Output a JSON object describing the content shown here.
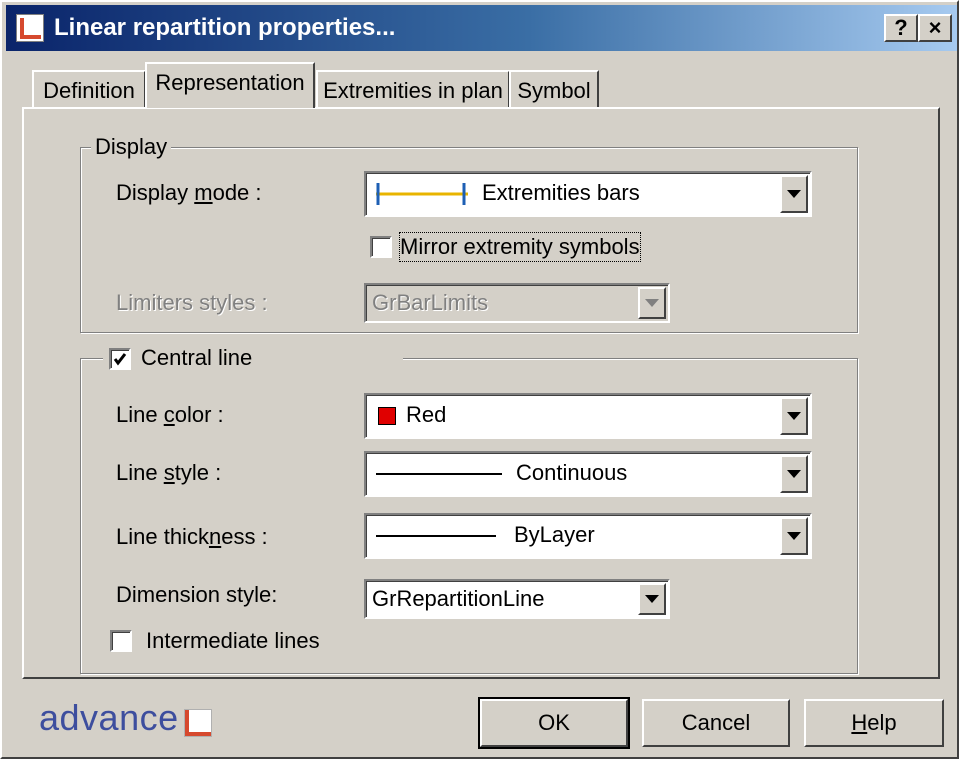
{
  "window": {
    "title": "Linear repartition properties...",
    "help_button": "?",
    "close_button": "×"
  },
  "tabs": [
    {
      "label": "Definition",
      "active": false
    },
    {
      "label": "Representation",
      "active": true
    },
    {
      "label": "Extremities in plan",
      "active": false
    },
    {
      "label": "Symbol",
      "active": false
    }
  ],
  "display_group": {
    "legend": "Display",
    "display_mode": {
      "label_pre": "Display ",
      "label_u": "m",
      "label_post": "ode :",
      "value": "Extremities bars"
    },
    "mirror_checkbox": {
      "label": "Mirror extremity symbols",
      "checked": false
    },
    "limiters_styles": {
      "label": "Limiters styles :",
      "value": "GrBarLimits",
      "disabled": true
    }
  },
  "central_group": {
    "legend": "Central line",
    "checked": true,
    "line_color": {
      "label_pre": "Line ",
      "label_u": "c",
      "label_post": "olor :",
      "value": "Red",
      "swatch": "#e00000"
    },
    "line_style": {
      "label_pre": "Line ",
      "label_u": "s",
      "label_post": "tyle :",
      "value": "Continuous"
    },
    "line_thickness": {
      "label_pre": "Line thick",
      "label_u": "n",
      "label_post": "ess :",
      "value": "ByLayer"
    },
    "dimension_style": {
      "label": "Dimension style:",
      "value": "GrRepartitionLine"
    },
    "intermediate_lines": {
      "label": "Intermediate lines",
      "checked": false
    }
  },
  "footer": {
    "brand": "advance",
    "ok": "OK",
    "cancel": "Cancel",
    "help_u": "H",
    "help_rest": "elp"
  },
  "colors": {
    "title_start": "#0a246a",
    "title_end": "#a6caf0",
    "face": "#d4d0c8",
    "accent_red": "#d6492e",
    "bar_yellow": "#e8b400",
    "bar_blue": "#1e5fb4",
    "brand_blue": "#3d4e9e"
  }
}
